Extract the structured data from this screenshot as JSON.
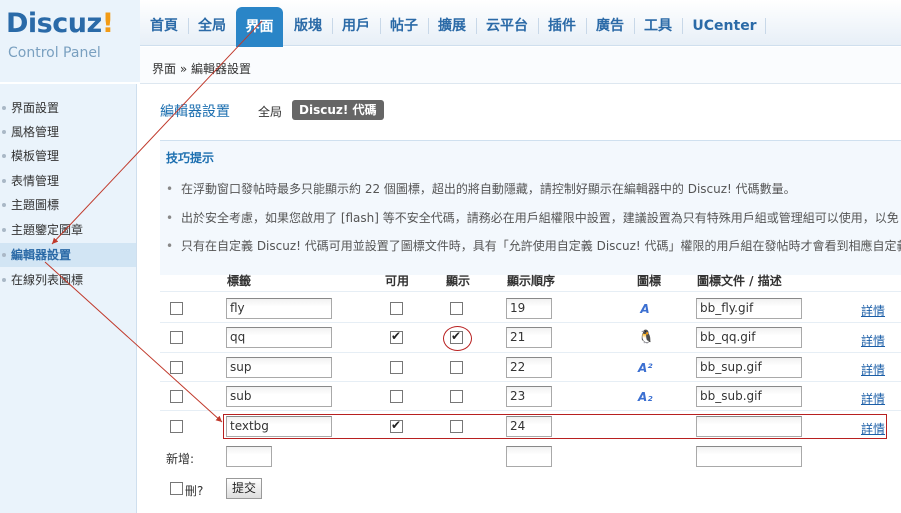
{
  "logo": {
    "brand": "Discuz",
    "bang": "!",
    "subtitle": "Control Panel"
  },
  "topnav": {
    "items": [
      "首頁",
      "全局",
      "界面",
      "版塊",
      "用戶",
      "帖子",
      "擴展",
      "云平台",
      "插件",
      "廣告",
      "工具",
      "UCenter"
    ],
    "active": "界面"
  },
  "breadcrumb": "界面 » 編輯器設置",
  "sidebar": {
    "items": [
      "界面設置",
      "風格管理",
      "模板管理",
      "表情管理",
      "主題圖標",
      "主題鑒定圖章",
      "編輯器設置",
      "在線列表圖標"
    ],
    "active": "編輯器設置"
  },
  "main": {
    "title": "編輯器設置",
    "tab_global": "全局",
    "tab_active": "Discuz! 代碼",
    "tips_title": "技巧提示",
    "tips": [
      "在浮動窗口發帖時最多只能顯示約 22 個圖標，超出的將自動隱藏，請控制好顯示在編輯器中的 Discuz! 代碼數量。",
      "出於安全考慮，如果您啟用了 [flash] 等不安全代碼，請務必在用戶組權限中設置，建議設置為只有特殊用戶組或管理組可以使用，以免",
      "只有在自定義 Discuz! 代碼可用並設置了圖標文件時，具有「允許使用自定義 Discuz! 代碼」權限的用戶組在發帖時才會看到相應自定義"
    ],
    "headers": {
      "tag": "標籤",
      "available": "可用",
      "display": "顯示",
      "order": "顯示順序",
      "icon": "圖標",
      "icon_file": "圖標文件 / 描述"
    },
    "rows": [
      {
        "tag": "fly",
        "available": false,
        "display": false,
        "order": "19",
        "icon": "A",
        "icon_file": "bb_fly.gif",
        "detail": "詳情"
      },
      {
        "tag": "qq",
        "available": true,
        "display": true,
        "order": "21",
        "icon": "qq",
        "icon_file": "bb_qq.gif",
        "detail": "詳情"
      },
      {
        "tag": "sup",
        "available": false,
        "display": false,
        "order": "22",
        "icon": "A²",
        "icon_file": "bb_sup.gif",
        "detail": "詳情"
      },
      {
        "tag": "sub",
        "available": false,
        "display": false,
        "order": "23",
        "icon": "A₂",
        "icon_file": "bb_sub.gif",
        "detail": "詳情"
      },
      {
        "tag": "textbg",
        "available": true,
        "display": false,
        "order": "24",
        "icon": "",
        "icon_file": "",
        "detail": "詳情"
      }
    ],
    "add_label": "新增:",
    "delete_label": "刪?",
    "submit_label": "提交"
  },
  "colors": {
    "accent": "#2a85c7",
    "link": "#1c6fb0",
    "annotation": "#b82020"
  },
  "icons": {
    "qq": "qq-penguin-icon",
    "edit": "bbcode-a-icon"
  }
}
